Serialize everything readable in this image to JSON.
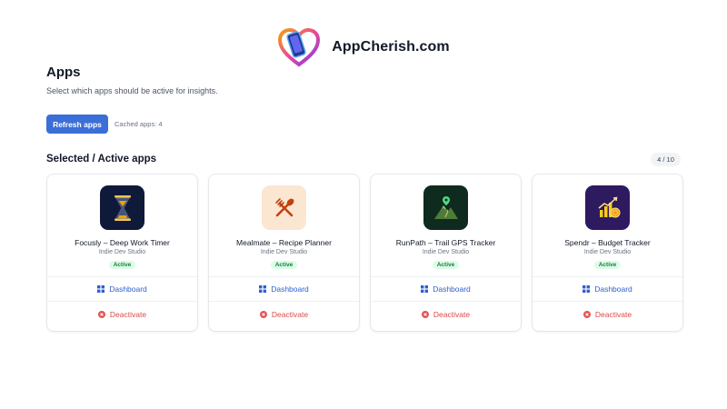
{
  "brand": {
    "name": "AppCherish.com",
    "logo": "heart-phone-logo"
  },
  "page": {
    "title": "Apps",
    "subtitle": "Select which apps should be active for insights."
  },
  "toolbar": {
    "refresh_label": "Refresh apps",
    "cached_text": "Cached apps: 4"
  },
  "section": {
    "title": "Selected / Active apps",
    "count": "4 / 10"
  },
  "apps": [
    {
      "name": "Focusly – Deep Work Timer",
      "developer": "Indie Dev Studio",
      "status": "Active",
      "icon": "hourglass-icon",
      "dashboard_label": "Dashboard",
      "deactivate_label": "Deactivate"
    },
    {
      "name": "Mealmate – Recipe Planner",
      "developer": "Indie Dev Studio",
      "status": "Active",
      "icon": "fork-spoon-icon",
      "dashboard_label": "Dashboard",
      "deactivate_label": "Deactivate"
    },
    {
      "name": "RunPath – Trail GPS Tracker",
      "developer": "Indie Dev Studio",
      "status": "Active",
      "icon": "mountain-pin-icon",
      "dashboard_label": "Dashboard",
      "deactivate_label": "Deactivate"
    },
    {
      "name": "Spendr – Budget Tracker",
      "developer": "Indie Dev Studio",
      "status": "Active",
      "icon": "coins-chart-icon",
      "dashboard_label": "Dashboard",
      "deactivate_label": "Deactivate"
    }
  ],
  "colors": {
    "primary": "#3b6fd8",
    "active_bg": "#dcfce7",
    "active_text": "#15803d",
    "danger": "#dc4a4a",
    "link": "#2f5fcc"
  }
}
